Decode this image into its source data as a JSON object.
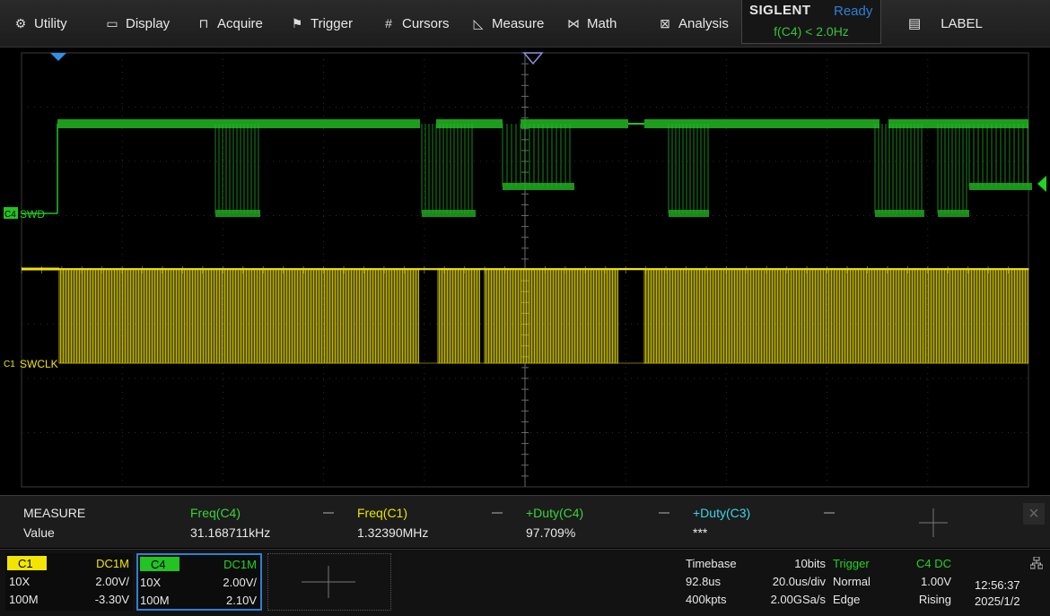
{
  "menu": {
    "utility": "Utility",
    "display": "Display",
    "acquire": "Acquire",
    "trigger": "Trigger",
    "cursors": "Cursors",
    "measure": "Measure",
    "math": "Math",
    "analysis": "Analysis",
    "label": "LABEL"
  },
  "brand": {
    "name": "SIGLENT",
    "status": "Ready",
    "trigger_condition": "f(C4) < 2.0Hz"
  },
  "channels_on_screen": {
    "c4_tag": "C4",
    "c4_label": "SWD",
    "c1_tag": "C1",
    "c1_label": "SWCLK"
  },
  "measure": {
    "title": "MEASURE",
    "row_label": "Value",
    "items": [
      {
        "name": "Freq(C4)",
        "value": "31.168711kHz",
        "color": "#39d339"
      },
      {
        "name": "Freq(C1)",
        "value": "1.32390MHz",
        "color": "#e6e600"
      },
      {
        "name": "+Duty(C4)",
        "value": "97.709%",
        "color": "#39d339"
      },
      {
        "name": "+Duty(C3)",
        "value": "***",
        "color": "#3ad6e6"
      }
    ]
  },
  "c1": {
    "name": "C1",
    "coupling": "DC1M",
    "probe": "10X",
    "scale": "2.00V/",
    "bw": "100M",
    "offset": "-3.30V",
    "color": "#f2e600"
  },
  "c4": {
    "name": "C4",
    "coupling": "DC1M",
    "probe": "10X",
    "scale": "2.00V/",
    "bw": "100M",
    "offset": "2.10V",
    "color": "#22c322"
  },
  "timebase": {
    "label": "Timebase",
    "bits": "10bits",
    "delay": "92.8us",
    "scale": "20.0us/div",
    "points": "400kpts",
    "rate": "2.00GSa/s"
  },
  "trigger": {
    "label": "Trigger",
    "source": "C4 DC",
    "mode": "Normal",
    "level": "1.00V",
    "type": "Edge",
    "slope": "Rising"
  },
  "clock": {
    "time": "12:56:37",
    "date": "2025/1/2"
  }
}
